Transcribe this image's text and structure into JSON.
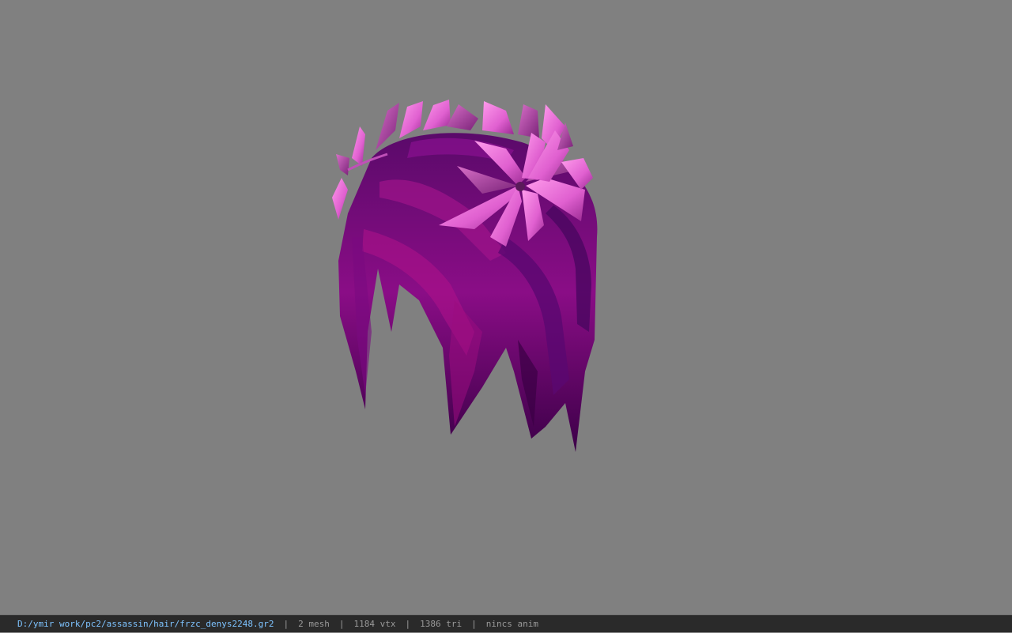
{
  "viewer": {
    "background_color": "#808080",
    "model_name": "hair model with flower crown",
    "colors": {
      "hair_dark": "#3a0040",
      "hair_mid": "#7a0a7a",
      "hair_light": "#a8108a",
      "petal_light": "#ff8ee8",
      "petal_mid": "#e060d0",
      "petal_dark": "#a02c9a"
    }
  },
  "status": {
    "file_path": "D:/ymir work/pc2/assassin/hair/frzc_denys2248.gr2",
    "mesh_count": "2 mesh",
    "vertex_count": "1184 vtx",
    "triangle_count": "1386 tri",
    "anim_info": "nincs anim",
    "separator": "|"
  }
}
